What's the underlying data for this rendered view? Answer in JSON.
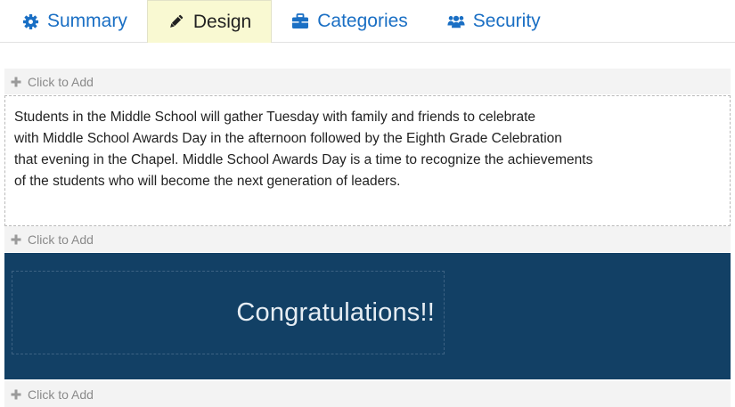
{
  "tabs": [
    {
      "label": "Summary",
      "icon": "gear-icon",
      "active": false
    },
    {
      "label": "Design",
      "icon": "pencil-icon",
      "active": true
    },
    {
      "label": "Categories",
      "icon": "briefcase-icon",
      "active": false
    },
    {
      "label": "Security",
      "icon": "users-icon",
      "active": false
    }
  ],
  "add_bars": [
    {
      "label": "Click to Add"
    },
    {
      "label": "Click to Add"
    },
    {
      "label": "Click to Add"
    }
  ],
  "text_block": {
    "lines": [
      "Students in the Middle School will gather Tuesday with family and friends to celebrate",
      "with Middle School Awards Day in the afternoon followed by the Eighth Grade Celebration",
      "that evening in the Chapel. Middle School Awards Day is a time to recognize the achievements",
      "of the students who will become the next generation of leaders."
    ]
  },
  "banner": {
    "title": "Congratulations!!"
  },
  "colors": {
    "tab_link": "#1a6fc4",
    "tab_active_bg": "#f9f9d2",
    "banner_bg": "#124065",
    "add_bar_bg": "#f3f3f3"
  }
}
